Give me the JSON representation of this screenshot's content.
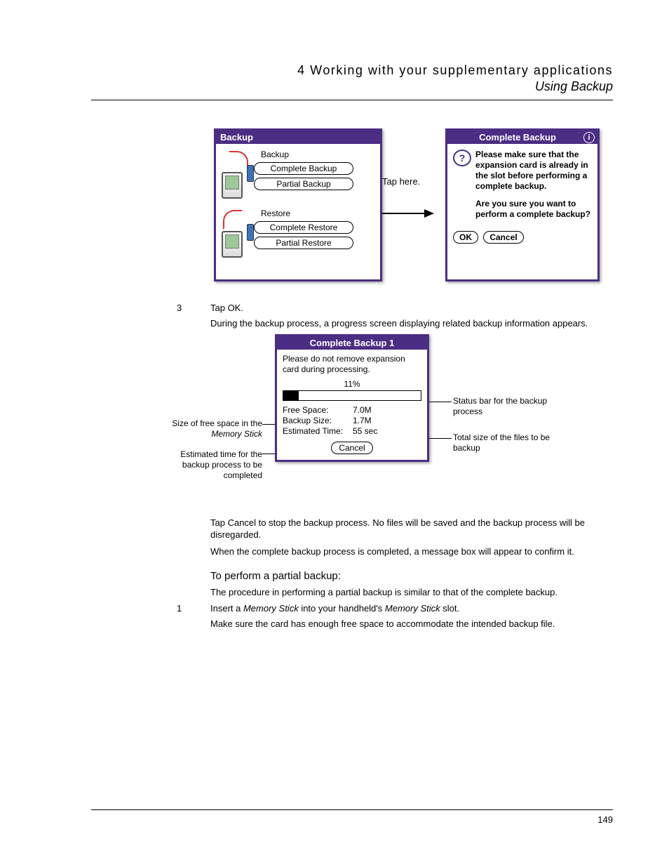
{
  "header": {
    "chapter": "4 Working with your supplementary applications",
    "section": "Using Backup"
  },
  "backup_app": {
    "title": "Backup",
    "sections": [
      {
        "heading": "Backup",
        "buttons": [
          "Complete Backup",
          "Partial Backup"
        ]
      },
      {
        "heading": "Restore",
        "buttons": [
          "Complete Restore",
          "Partial Restore"
        ]
      }
    ]
  },
  "tap_label": "Tap here.",
  "dialog": {
    "title": "Complete Backup",
    "info_icon": "i",
    "question_icon": "?",
    "message1": "Please make sure that the expansion card is already in the slot before performing a complete backup.",
    "message2": "Are you sure you want to perform a complete backup?",
    "ok": "OK",
    "cancel": "Cancel"
  },
  "step3": {
    "num": "3",
    "text": "Tap OK.",
    "para": "During the backup process, a progress screen displaying related backup information appears."
  },
  "progress": {
    "title": "Complete Backup 1",
    "please": "Please do not remove expansion card during processing.",
    "percent_text": "11%",
    "percent_value": 11,
    "rows": {
      "free_space": {
        "label": "Free Space:",
        "value": "7.0M"
      },
      "backup_size": {
        "label": "Backup Size:",
        "value": "1.7M"
      },
      "estimated_time": {
        "label": "Estimated Time:",
        "value": "55 sec"
      }
    },
    "cancel": "Cancel"
  },
  "annotations": {
    "status_bar": "Status bar for the backup process",
    "free_space": "Size of free space in the",
    "free_space_italic": "Memory Stick",
    "est_time": "Estimated time for the backup process to be completed",
    "backup_size": "Total size of the files to be backup"
  },
  "body": {
    "p1": "Tap Cancel to stop the backup process. No files will be saved and the backup process will be disregarded.",
    "p2": "When the complete backup process is completed, a message box will appear to confirm it.",
    "subhead": "To perform a partial backup:",
    "p3": "The procedure in performing a partial backup is similar to that of the complete backup.",
    "step1_num": "1",
    "step1_a": "Insert a ",
    "step1_b": "Memory Stick",
    "step1_c": " into your handheld's ",
    "step1_d": "Memory Stick",
    "step1_e": " slot.",
    "step1_p": "Make sure the card has enough free space to accommodate the intended backup file."
  },
  "footer": {
    "page": "149"
  }
}
